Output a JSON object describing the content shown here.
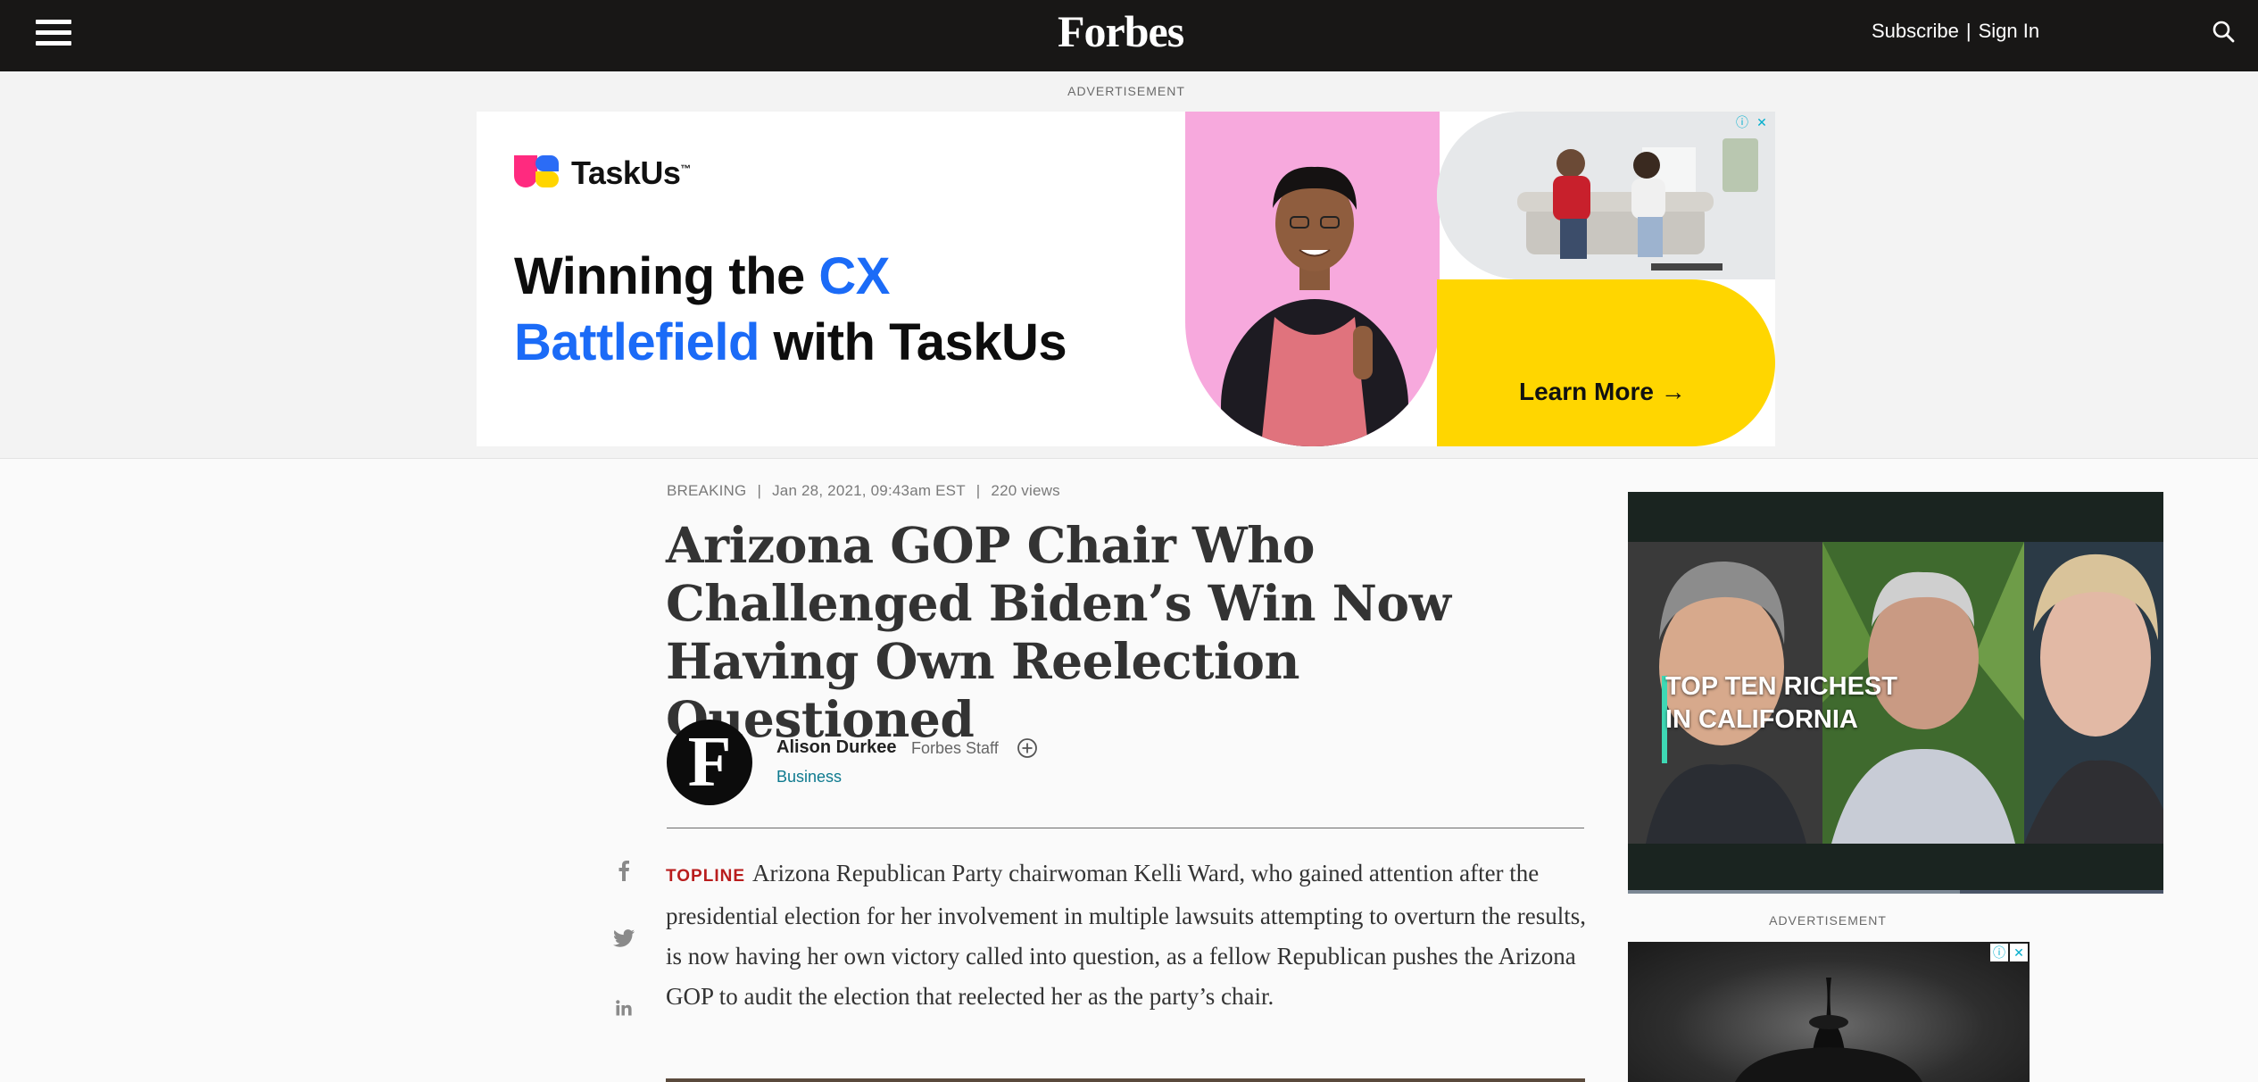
{
  "nav": {
    "logo": "Forbes",
    "subscribe": "Subscribe",
    "separator": "|",
    "sign_in": "Sign In",
    "icons": [
      "menu-icon",
      "search-icon"
    ]
  },
  "ad_top": {
    "label": "ADVERTISEMENT",
    "brand": "TaskUs",
    "brand_tm": "™",
    "headline_1": "Winning the ",
    "headline_cx": "CX",
    "headline_battlefield": "Battlefield",
    "headline_2": " with TaskUs",
    "cta": "Learn More →",
    "colors": {
      "blue": "#1b6bf7",
      "pink": "#f7a9dd",
      "yellow": "#ffd600"
    }
  },
  "article": {
    "category": "BREAKING",
    "date": "Jan 28, 2021, 09:43am EST",
    "views": "220 views",
    "separator": "|",
    "headline": "Arizona GOP Chair Who Challenged Biden’s Win Now Having Own Reelection Questioned",
    "author": {
      "initial": "F",
      "name": "Alison Durkee",
      "role": "Forbes Staff",
      "channel": "Business"
    },
    "topline_label": "TOPLINE",
    "body": "Arizona Republican Party chairwoman Kelli Ward, who gained attention after the presidential election for her involvement in multiple lawsuits attempting to overturn the results, is now having her own victory called into question, as a fellow Republican pushes the Arizona GOP to audit the election that reelected her as the party’s chair.",
    "social": [
      "facebook-icon",
      "twitter-icon",
      "linkedin-icon"
    ]
  },
  "rail": {
    "video_title_1": "TOP TEN RICHEST",
    "video_title_2": "IN CALIFORNIA",
    "video_progress": 0.62,
    "ad_label": "ADVERTISEMENT"
  }
}
